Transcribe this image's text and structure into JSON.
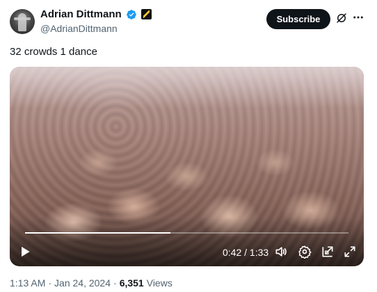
{
  "author": {
    "display_name": "Adrian Dittmann",
    "handle": "@AdrianDittmann",
    "verified_color": "#1d9bf0"
  },
  "header": {
    "subscribe_label": "Subscribe",
    "grok_icon": "grok-icon",
    "more_icon": "more-icon"
  },
  "tweet": {
    "text": "32 crowds 1 dance"
  },
  "video": {
    "current_time": "0:42",
    "separator": " / ",
    "duration": "1:33",
    "progress": 0.45,
    "controls": [
      "play-icon",
      "volume-icon",
      "settings-icon",
      "pip-icon",
      "fullscreen-icon"
    ]
  },
  "meta": {
    "time": "1:13 AM",
    "dot1": "·",
    "date": "Jan 24, 2024",
    "dot2": "·",
    "views_count": "6,351",
    "views_label": "Views"
  }
}
